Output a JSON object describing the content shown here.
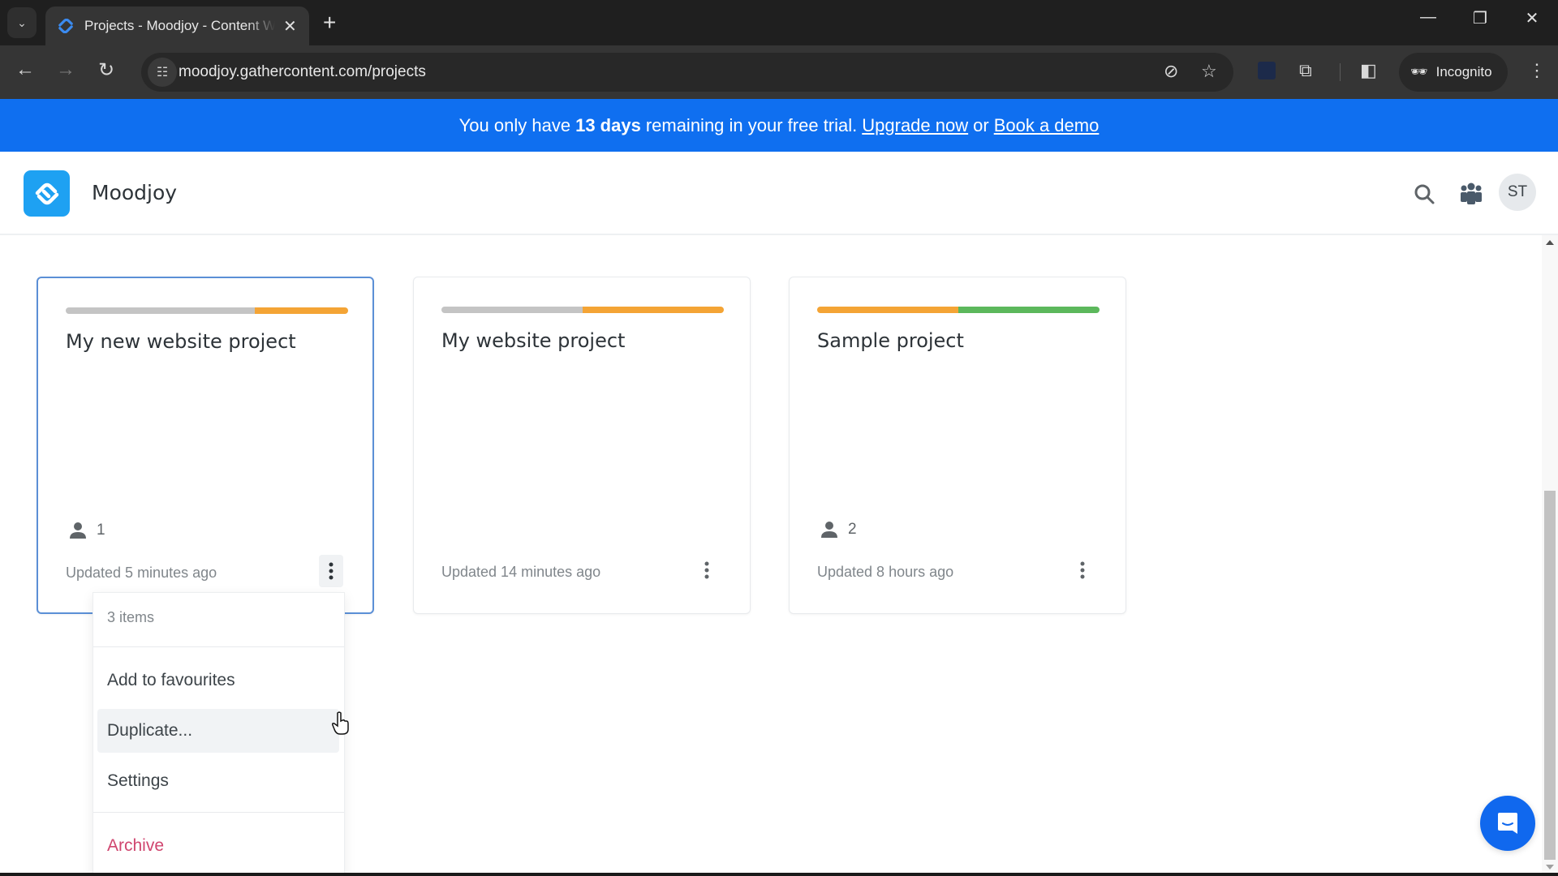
{
  "browser": {
    "tab_title": "Projects - Moodjoy - Content W",
    "url": "moodjoy.gathercontent.com/projects",
    "incognito_label": "Incognito",
    "new_tab_symbol": "+",
    "close_symbol": "✕"
  },
  "banner": {
    "prefix": "You only have",
    "days": "13 days",
    "middle": "remaining in your free trial.",
    "upgrade_link": "Upgrade now",
    "or": "or",
    "demo_link": "Book a demo",
    "color": "#0f6ff0"
  },
  "header": {
    "org_name": "Moodjoy",
    "avatar_initials": "ST",
    "brand_color": "#1ea1f2"
  },
  "status_colors": {
    "gray": "#c4c4c4",
    "orange": "#f4a435",
    "green": "#5cb85c"
  },
  "projects": [
    {
      "title": "My new website project",
      "members": "1",
      "updated": "Updated 5 minutes ago",
      "progress": [
        {
          "status": "gray",
          "fraction": 0.67
        },
        {
          "status": "orange",
          "fraction": 0.33
        }
      ]
    },
    {
      "title": "My website project",
      "members": "",
      "updated": "Updated 14 minutes ago",
      "progress": [
        {
          "status": "gray",
          "fraction": 0.5
        },
        {
          "status": "orange",
          "fraction": 0.5
        }
      ]
    },
    {
      "title": "Sample project",
      "members": "2",
      "updated": "Updated 8 hours ago",
      "progress": [
        {
          "status": "orange",
          "fraction": 0.5
        },
        {
          "status": "green",
          "fraction": 0.5
        }
      ]
    }
  ],
  "context_menu": {
    "count": "3 items",
    "items": [
      "Add to favourites",
      "Duplicate...",
      "Settings"
    ],
    "danger_item": "Archive"
  }
}
